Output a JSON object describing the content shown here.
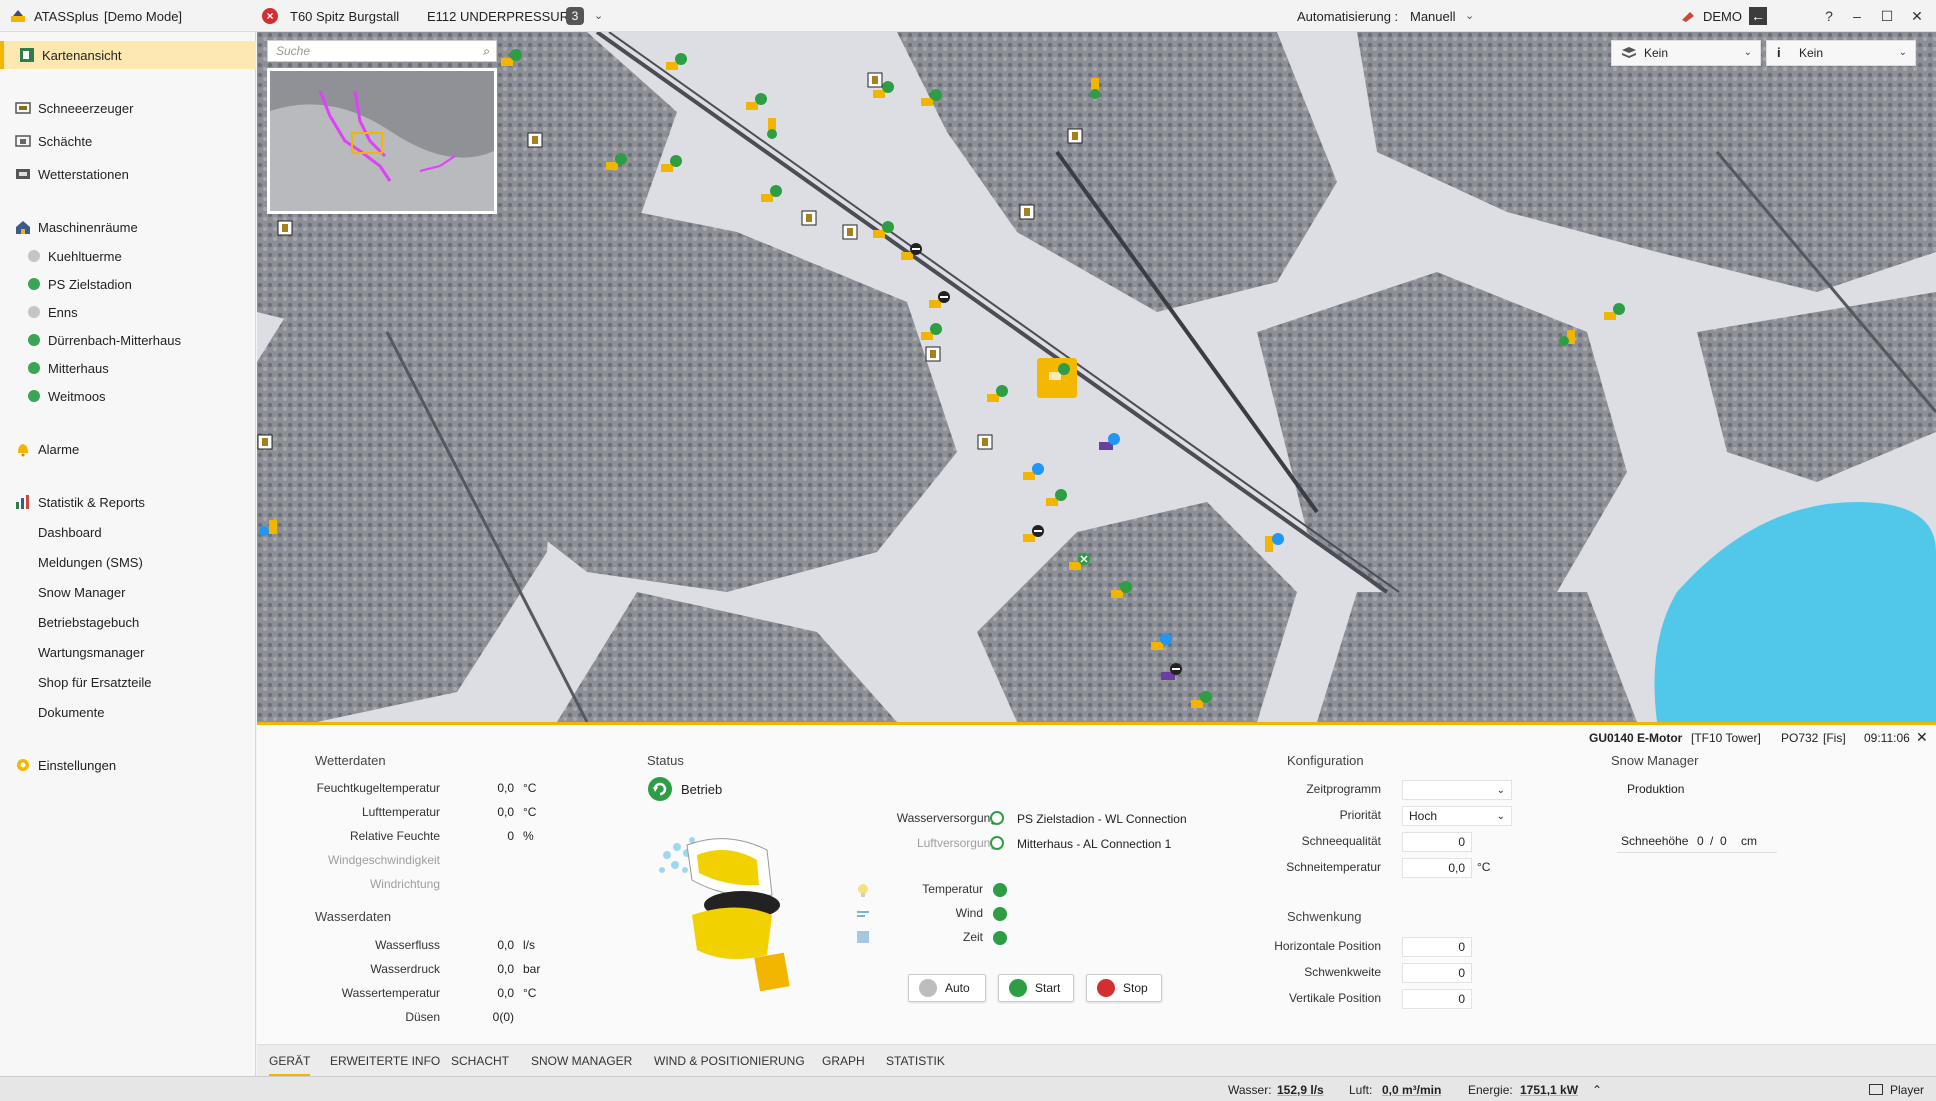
{
  "titlebar": {
    "app_name": "ATASSplus",
    "mode": "[Demo Mode]",
    "alarm_device": "T60 Spitz Burgstall",
    "alarm_message": "E112 UNDERPRESSURE",
    "alarm_count": "3",
    "auto_label": "Automatisierung :",
    "auto_value": "Manuell",
    "demo_label": "DEMO",
    "help": "?",
    "minimize": "–",
    "maximize": "☐",
    "close": "✕"
  },
  "sidebar": {
    "kartenansicht": "Kartenansicht",
    "schneeerzeuger": "Schneeerzeuger",
    "schaechte": "Schächte",
    "wetterstationen": "Wetterstationen",
    "maschinenraeume": "Maschinenräume",
    "rooms": [
      {
        "label": "Kuehltuerme",
        "status": "grey"
      },
      {
        "label": "PS Zielstadion",
        "status": "green"
      },
      {
        "label": "Enns",
        "status": "grey"
      },
      {
        "label": "Dürrenbach-Mitterhaus",
        "status": "green"
      },
      {
        "label": "Mitterhaus",
        "status": "green"
      },
      {
        "label": "Weitmoos",
        "status": "green"
      }
    ],
    "alarme": "Alarme",
    "statistik": "Statistik & Reports",
    "reports": [
      "Dashboard",
      "Meldungen (SMS)",
      "Snow Manager",
      "Betriebstagebuch",
      "Wartungsmanager",
      "Shop für Ersatzteile",
      "Dokumente"
    ],
    "einstellungen": "Einstellungen"
  },
  "map": {
    "search_placeholder": "Suche",
    "layer1": "Kein",
    "layer2": "Kein"
  },
  "detail": {
    "device_name": "GU0140 E-Motor",
    "device_type": "[TF10 Tower]",
    "device_location": "PO732",
    "device_piste": "[Fis]",
    "time": "09:11:06",
    "wetterdaten": {
      "title": "Wetterdaten",
      "rows": [
        {
          "label": "Feuchtkugeltemperatur",
          "value": "0,0",
          "unit": "°C",
          "dim": false
        },
        {
          "label": "Lufttemperatur",
          "value": "0,0",
          "unit": "°C",
          "dim": false
        },
        {
          "label": "Relative Feuchte",
          "value": "0",
          "unit": "%",
          "dim": false
        },
        {
          "label": "Windgeschwindigkeit",
          "value": "",
          "unit": "",
          "dim": true
        },
        {
          "label": "Windrichtung",
          "value": "",
          "unit": "",
          "dim": true
        }
      ]
    },
    "wasserdaten": {
      "title": "Wasserdaten",
      "rows": [
        {
          "label": "Wasserfluss",
          "value": "0,0",
          "unit": "l/s"
        },
        {
          "label": "Wasserdruck",
          "value": "0,0",
          "unit": "bar"
        },
        {
          "label": "Wassertemperatur",
          "value": "0,0",
          "unit": "°C"
        },
        {
          "label": "Düsen",
          "value": "0(0)",
          "unit": ""
        }
      ]
    },
    "status": {
      "title": "Status",
      "state": "Betrieb",
      "wasserversorgung_label": "Wasserversorgung",
      "wasserversorgung_value": "PS Zielstadion - WL Connection",
      "luftversorgung_label": "Luftversorgung",
      "luftversorgung_value": "Mitterhaus - AL Connection 1",
      "temperatur": "Temperatur",
      "wind": "Wind",
      "zeit": "Zeit",
      "btn_auto": "Auto",
      "btn_start": "Start",
      "btn_stop": "Stop"
    },
    "konfiguration": {
      "title": "Konfiguration",
      "zeitprogramm_label": "Zeitprogramm",
      "zeitprogramm_value": "",
      "prioritaet_label": "Priorität",
      "prioritaet_value": "Hoch",
      "schneequalitaet_label": "Schneequalität",
      "schneequalitaet_value": "0",
      "schneitemperatur_label": "Schneitemperatur",
      "schneitemperatur_value": "0,0",
      "schneitemperatur_unit": "°C"
    },
    "schwenkung": {
      "title": "Schwenkung",
      "horizontal_label": "Horizontale Position",
      "horizontal_value": "0",
      "schwenkweite_label": "Schwenkweite",
      "schwenkweite_value": "0",
      "vertikal_label": "Vertikale Position",
      "vertikal_value": "0"
    },
    "snow_manager": {
      "title": "Snow Manager",
      "produktion": "Produktion",
      "schneehoehe_label": "Schneehöhe",
      "schneehoehe_a": "0",
      "separator": "/",
      "schneehoehe_b": "0",
      "unit": "cm"
    }
  },
  "tabs": [
    "GERÄT",
    "ERWEITERTE INFO",
    "SCHACHT",
    "SNOW MANAGER",
    "WIND & POSITIONIERUNG",
    "GRAPH",
    "STATISTIK"
  ],
  "statusbar": {
    "wasser_label": "Wasser:",
    "wasser_value": "152,9 l/s",
    "luft_label": "Luft:",
    "luft_value": "0,0 m³/min",
    "energie_label": "Energie:",
    "energie_value": "1751,1 kW",
    "player": "Player"
  },
  "colors": {
    "accent": "#f2b600",
    "ok_green": "#2e9e44",
    "alarm_red": "#d32f2f"
  }
}
